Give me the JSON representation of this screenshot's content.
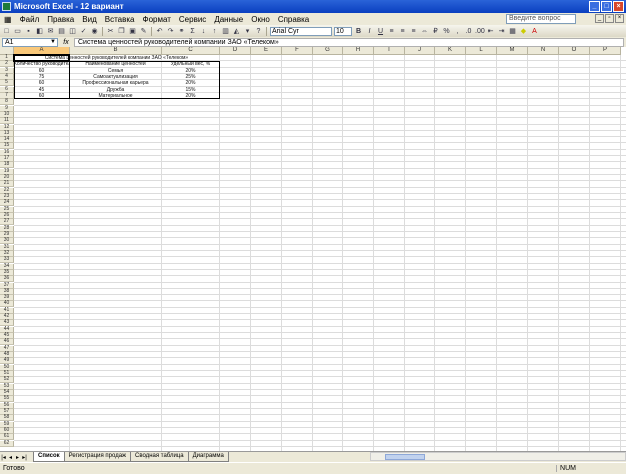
{
  "window": {
    "title": "Microsoft Excel - 12 вариант"
  },
  "menu": {
    "items": [
      "Файл",
      "Правка",
      "Вид",
      "Вставка",
      "Формат",
      "Сервис",
      "Данные",
      "Окно",
      "Справка"
    ],
    "help_placeholder": "Введите вопрос"
  },
  "toolbar": {
    "font_name": "Arial Cyr",
    "font_size": "10"
  },
  "formula_bar": {
    "cell_ref": "A1",
    "fx": "fx",
    "content": "Система ценностей руководителей компании ЗАО «Телеком»"
  },
  "columns": [
    "A",
    "B",
    "C",
    "D",
    "E",
    "F",
    "G",
    "H",
    "I",
    "J",
    "K",
    "L",
    "M",
    "N",
    "O",
    "P"
  ],
  "rows": [
    "1",
    "2",
    "3",
    "4",
    "5",
    "6",
    "7",
    "8",
    "9",
    "10",
    "11",
    "12",
    "13",
    "14",
    "15",
    "16",
    "17",
    "18",
    "19",
    "20",
    "21",
    "22",
    "23",
    "24",
    "25",
    "26",
    "27",
    "28",
    "29",
    "30",
    "31",
    "32",
    "33",
    "34",
    "35",
    "36",
    "37",
    "38",
    "39",
    "40",
    "41",
    "42",
    "43",
    "44",
    "45",
    "46",
    "47",
    "48",
    "49",
    "50",
    "51",
    "52",
    "53",
    "54",
    "55",
    "56",
    "57",
    "58",
    "59",
    "60",
    "61",
    "62"
  ],
  "table": {
    "title": "Система ценностей руководителей компании ЗАО «Телеком»",
    "headers": [
      "Количество руководителей",
      "Наименование ценностей",
      "Удельный вес, %"
    ],
    "data": [
      [
        "60",
        "Семья",
        "20%"
      ],
      [
        "75",
        "Самоактуализация",
        "25%"
      ],
      [
        "60",
        "Профессиональная карьера",
        "20%"
      ],
      [
        "45",
        "Дружба",
        "15%"
      ],
      [
        "60",
        "Материальное",
        "20%"
      ]
    ]
  },
  "sheets": {
    "tabs": [
      "Список",
      "Регистрация продаж",
      "Сводная таблица",
      "Диаграмма"
    ],
    "active": 0
  },
  "status": {
    "left": "Готово",
    "right": "NUM"
  }
}
